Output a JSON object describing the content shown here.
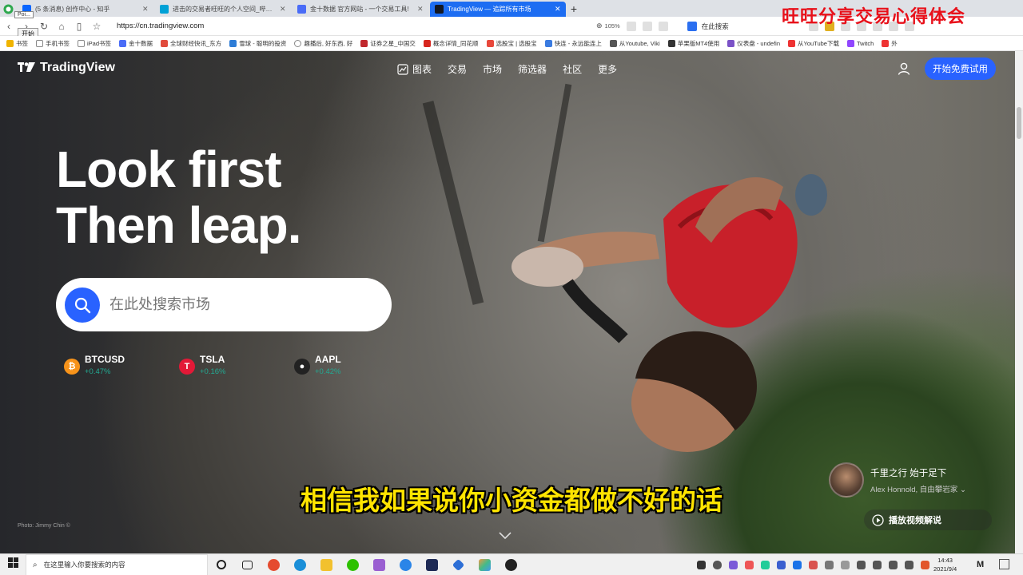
{
  "browser": {
    "tabs": [
      {
        "title": "(5 条消息) 创作中心 - 知乎",
        "color": "#0a66ff"
      },
      {
        "title": "进击的交易者旺旺的个人空间_哔哩哔哩",
        "color": "#00a1d6"
      },
      {
        "title": "金十数据 官方网站 - 一个交易工具!",
        "color": "#4a6cf7"
      },
      {
        "title": "TradingView — 追踪所有市场",
        "color": "#131722"
      }
    ],
    "new_tab": "+",
    "url": "https://cn.tradingview.com",
    "zoom": "105%",
    "search_here": "在此搜索",
    "tooltip": "Poi...",
    "open_button": "开始",
    "bookmarks": [
      "书签",
      "手机书签",
      "iPad书签",
      "金十数据",
      "全球财经快讯_东方",
      "雪球 - 聪明的投资",
      "趣播后, 好东西, 好",
      "证券之星_中国交",
      "概念详情_同花顺",
      "选股宝 | 选股宝",
      "快连 - 永远能连上",
      "从Youtube, Viki",
      "苹果版MT4使用",
      "仪表盘 - undefin",
      "从YouTube下载",
      "Twitch",
      "外"
    ]
  },
  "watermark": "旺旺分享交易心得体会",
  "tv": {
    "logo": "TradingView",
    "nav": [
      "图表",
      "交易",
      "市场",
      "筛选器",
      "社区",
      "更多"
    ],
    "cta": "开始免费试用",
    "hero_line1": "Look first",
    "hero_line2": "Then leap.",
    "search_placeholder": "在此处搜索市场",
    "tickers": [
      {
        "symbol": "BTCUSD",
        "change": "+0.47%",
        "icon": "bitcoin-icon",
        "icon_color": "#f7931a"
      },
      {
        "symbol": "TSLA",
        "change": "+0.16%",
        "icon": "tesla-icon",
        "icon_color": "#e31937"
      },
      {
        "symbol": "AAPL",
        "change": "+0.42%",
        "icon": "apple-icon",
        "icon_color": "#222222"
      }
    ],
    "photo_credit": "Photo: Jimmy Chin ©",
    "quote_title": "千里之行 始于足下",
    "quote_sub": "Alex Honnold, 自由攀岩家",
    "play_label": "播放视频解说"
  },
  "subtitle": "相信我如果说你小资金都做不好的话",
  "taskbar": {
    "search_placeholder": "在这里输入你要搜索的内容",
    "time": "14:43",
    "date": "2021/9/4"
  }
}
